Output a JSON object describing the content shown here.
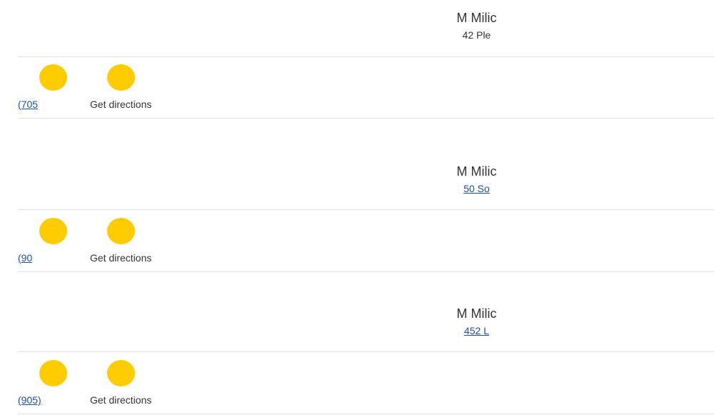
{
  "listings": [
    {
      "name": "M Milic",
      "address": "42 Ple",
      "address_is_link": false,
      "phone": "(705",
      "directions_label": "Get directions"
    },
    {
      "name": "M Milic",
      "address": "50 So",
      "address_is_link": true,
      "phone": "(90",
      "directions_label": "Get directions"
    },
    {
      "name": "M Milic",
      "address": "452 L",
      "address_is_link": true,
      "phone": "(905)",
      "directions_label": "Get directions"
    }
  ],
  "colors": {
    "accent_circle": "#ffcc00",
    "link": "#1f4fa3",
    "text": "#333333",
    "divider": "#e2e2e2"
  },
  "icons": [
    "phone-icon",
    "directions-icon"
  ]
}
